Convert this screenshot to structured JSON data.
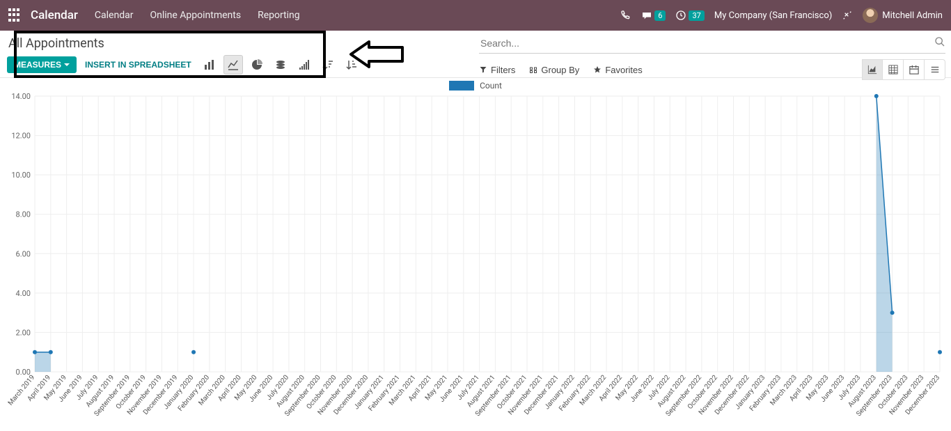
{
  "header": {
    "brand": "Calendar",
    "nav": [
      "Calendar",
      "Online Appointments",
      "Reporting"
    ],
    "messages_badge": "6",
    "activities_badge": "37",
    "company": "My Company (San Francisco)",
    "user": "Mitchell Admin"
  },
  "page": {
    "title": "All Appointments",
    "measures_btn": "MEASURES",
    "insert_btn": "INSERT IN SPREADSHEET"
  },
  "search": {
    "placeholder": "Search...",
    "filters": "Filters",
    "group_by": "Group By",
    "favorites": "Favorites"
  },
  "legend": {
    "label": "Count"
  },
  "chart_data": {
    "type": "line",
    "title": "",
    "xlabel": "",
    "ylabel": "",
    "ylim": [
      0,
      14
    ],
    "yticks": [
      0,
      2,
      4,
      6,
      8,
      10,
      12,
      14
    ],
    "ytick_labels": [
      "0.00",
      "2.00",
      "4.00",
      "6.00",
      "8.00",
      "10.00",
      "12.00",
      "14.00"
    ],
    "categories": [
      "March 2019",
      "April 2019",
      "May 2019",
      "June 2019",
      "July 2019",
      "August 2019",
      "September 2019",
      "October 2019",
      "November 2019",
      "December 2019",
      "January 2020",
      "February 2020",
      "March 2020",
      "April 2020",
      "May 2020",
      "June 2020",
      "July 2020",
      "August 2020",
      "September 2020",
      "October 2020",
      "November 2020",
      "December 2020",
      "January 2021",
      "February 2021",
      "March 2021",
      "April 2021",
      "May 2021",
      "June 2021",
      "July 2021",
      "August 2021",
      "September 2021",
      "October 2021",
      "November 2021",
      "December 2021",
      "January 2022",
      "February 2022",
      "March 2022",
      "April 2022",
      "May 2022",
      "June 2022",
      "July 2022",
      "August 2022",
      "September 2022",
      "October 2022",
      "November 2022",
      "December 2022",
      "January 2023",
      "February 2023",
      "March 2023",
      "April 2023",
      "May 2023",
      "June 2023",
      "July 2023",
      "August 2023",
      "September 2023",
      "October 2023",
      "November 2023",
      "December 2023"
    ],
    "series": [
      {
        "name": "Count",
        "values": [
          1,
          1,
          0,
          0,
          0,
          0,
          0,
          0,
          0,
          0,
          1,
          0,
          0,
          0,
          0,
          0,
          0,
          0,
          0,
          0,
          0,
          0,
          0,
          0,
          0,
          0,
          0,
          0,
          0,
          0,
          0,
          0,
          0,
          0,
          0,
          0,
          0,
          0,
          0,
          0,
          0,
          0,
          0,
          0,
          0,
          0,
          0,
          0,
          0,
          0,
          0,
          0,
          0,
          14,
          3,
          0,
          0,
          1
        ]
      }
    ]
  }
}
